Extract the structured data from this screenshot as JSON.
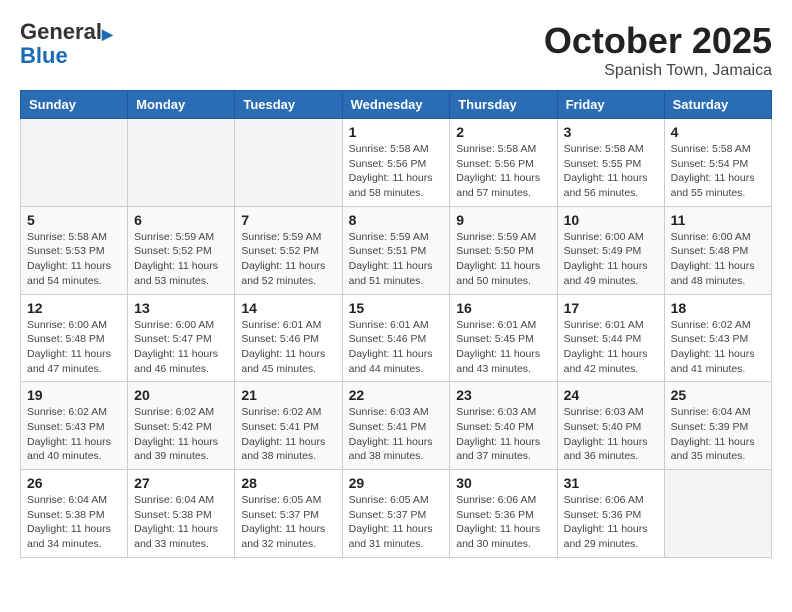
{
  "header": {
    "logo_line1": "General",
    "logo_line2": "Blue",
    "month": "October 2025",
    "location": "Spanish Town, Jamaica"
  },
  "weekdays": [
    "Sunday",
    "Monday",
    "Tuesday",
    "Wednesday",
    "Thursday",
    "Friday",
    "Saturday"
  ],
  "weeks": [
    [
      {
        "day": "",
        "info": ""
      },
      {
        "day": "",
        "info": ""
      },
      {
        "day": "",
        "info": ""
      },
      {
        "day": "1",
        "info": "Sunrise: 5:58 AM\nSunset: 5:56 PM\nDaylight: 11 hours and 58 minutes."
      },
      {
        "day": "2",
        "info": "Sunrise: 5:58 AM\nSunset: 5:56 PM\nDaylight: 11 hours and 57 minutes."
      },
      {
        "day": "3",
        "info": "Sunrise: 5:58 AM\nSunset: 5:55 PM\nDaylight: 11 hours and 56 minutes."
      },
      {
        "day": "4",
        "info": "Sunrise: 5:58 AM\nSunset: 5:54 PM\nDaylight: 11 hours and 55 minutes."
      }
    ],
    [
      {
        "day": "5",
        "info": "Sunrise: 5:58 AM\nSunset: 5:53 PM\nDaylight: 11 hours and 54 minutes."
      },
      {
        "day": "6",
        "info": "Sunrise: 5:59 AM\nSunset: 5:52 PM\nDaylight: 11 hours and 53 minutes."
      },
      {
        "day": "7",
        "info": "Sunrise: 5:59 AM\nSunset: 5:52 PM\nDaylight: 11 hours and 52 minutes."
      },
      {
        "day": "8",
        "info": "Sunrise: 5:59 AM\nSunset: 5:51 PM\nDaylight: 11 hours and 51 minutes."
      },
      {
        "day": "9",
        "info": "Sunrise: 5:59 AM\nSunset: 5:50 PM\nDaylight: 11 hours and 50 minutes."
      },
      {
        "day": "10",
        "info": "Sunrise: 6:00 AM\nSunset: 5:49 PM\nDaylight: 11 hours and 49 minutes."
      },
      {
        "day": "11",
        "info": "Sunrise: 6:00 AM\nSunset: 5:48 PM\nDaylight: 11 hours and 48 minutes."
      }
    ],
    [
      {
        "day": "12",
        "info": "Sunrise: 6:00 AM\nSunset: 5:48 PM\nDaylight: 11 hours and 47 minutes."
      },
      {
        "day": "13",
        "info": "Sunrise: 6:00 AM\nSunset: 5:47 PM\nDaylight: 11 hours and 46 minutes."
      },
      {
        "day": "14",
        "info": "Sunrise: 6:01 AM\nSunset: 5:46 PM\nDaylight: 11 hours and 45 minutes."
      },
      {
        "day": "15",
        "info": "Sunrise: 6:01 AM\nSunset: 5:46 PM\nDaylight: 11 hours and 44 minutes."
      },
      {
        "day": "16",
        "info": "Sunrise: 6:01 AM\nSunset: 5:45 PM\nDaylight: 11 hours and 43 minutes."
      },
      {
        "day": "17",
        "info": "Sunrise: 6:01 AM\nSunset: 5:44 PM\nDaylight: 11 hours and 42 minutes."
      },
      {
        "day": "18",
        "info": "Sunrise: 6:02 AM\nSunset: 5:43 PM\nDaylight: 11 hours and 41 minutes."
      }
    ],
    [
      {
        "day": "19",
        "info": "Sunrise: 6:02 AM\nSunset: 5:43 PM\nDaylight: 11 hours and 40 minutes."
      },
      {
        "day": "20",
        "info": "Sunrise: 6:02 AM\nSunset: 5:42 PM\nDaylight: 11 hours and 39 minutes."
      },
      {
        "day": "21",
        "info": "Sunrise: 6:02 AM\nSunset: 5:41 PM\nDaylight: 11 hours and 38 minutes."
      },
      {
        "day": "22",
        "info": "Sunrise: 6:03 AM\nSunset: 5:41 PM\nDaylight: 11 hours and 38 minutes."
      },
      {
        "day": "23",
        "info": "Sunrise: 6:03 AM\nSunset: 5:40 PM\nDaylight: 11 hours and 37 minutes."
      },
      {
        "day": "24",
        "info": "Sunrise: 6:03 AM\nSunset: 5:40 PM\nDaylight: 11 hours and 36 minutes."
      },
      {
        "day": "25",
        "info": "Sunrise: 6:04 AM\nSunset: 5:39 PM\nDaylight: 11 hours and 35 minutes."
      }
    ],
    [
      {
        "day": "26",
        "info": "Sunrise: 6:04 AM\nSunset: 5:38 PM\nDaylight: 11 hours and 34 minutes."
      },
      {
        "day": "27",
        "info": "Sunrise: 6:04 AM\nSunset: 5:38 PM\nDaylight: 11 hours and 33 minutes."
      },
      {
        "day": "28",
        "info": "Sunrise: 6:05 AM\nSunset: 5:37 PM\nDaylight: 11 hours and 32 minutes."
      },
      {
        "day": "29",
        "info": "Sunrise: 6:05 AM\nSunset: 5:37 PM\nDaylight: 11 hours and 31 minutes."
      },
      {
        "day": "30",
        "info": "Sunrise: 6:06 AM\nSunset: 5:36 PM\nDaylight: 11 hours and 30 minutes."
      },
      {
        "day": "31",
        "info": "Sunrise: 6:06 AM\nSunset: 5:36 PM\nDaylight: 11 hours and 29 minutes."
      },
      {
        "day": "",
        "info": ""
      }
    ]
  ]
}
